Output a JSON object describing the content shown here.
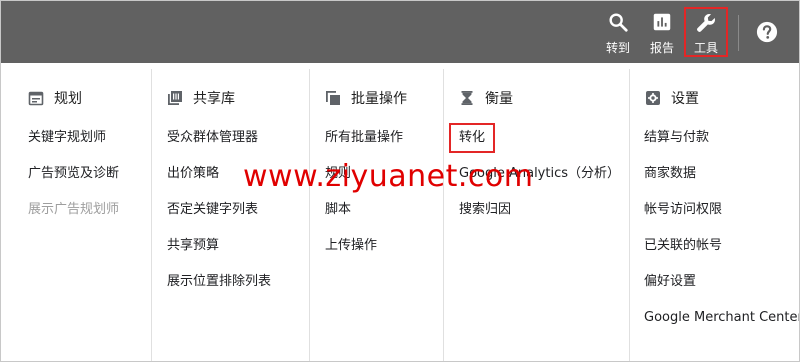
{
  "topbar": {
    "goto": {
      "label": "转到",
      "icon": "search-icon"
    },
    "reports": {
      "label": "报告",
      "icon": "bar-chart-icon"
    },
    "tools": {
      "label": "工具",
      "icon": "wrench-icon"
    },
    "help": {
      "icon": "help-icon"
    }
  },
  "columns": [
    {
      "title": "规划",
      "icon": "calendar-icon",
      "items": [
        {
          "label": "关键字规划师"
        },
        {
          "label": "广告预览及诊断"
        },
        {
          "label": "展示广告规划师"
        }
      ]
    },
    {
      "title": "共享库",
      "icon": "library-icon",
      "items": [
        {
          "label": "受众群体管理器"
        },
        {
          "label": "出价策略"
        },
        {
          "label": "否定关键字列表"
        },
        {
          "label": "共享预算"
        },
        {
          "label": "展示位置排除列表"
        }
      ]
    },
    {
      "title": "批量操作",
      "icon": "copy-icon",
      "items": [
        {
          "label": "所有批量操作"
        },
        {
          "label": "规则"
        },
        {
          "label": "脚本"
        },
        {
          "label": "上传操作"
        }
      ]
    },
    {
      "title": "衡量",
      "icon": "hourglass-icon",
      "items": [
        {
          "label": "转化"
        },
        {
          "label": "Google Analytics（分析）"
        },
        {
          "label": "搜索归因"
        }
      ]
    },
    {
      "title": "设置",
      "icon": "gear-icon",
      "items": [
        {
          "label": "结算与付款"
        },
        {
          "label": "商家数据"
        },
        {
          "label": "帐号访问权限"
        },
        {
          "label": "已关联的帐号"
        },
        {
          "label": "偏好设置"
        },
        {
          "label": "Google Merchant Center"
        }
      ]
    }
  ],
  "watermark": "www.ziyuanet.com",
  "colors": {
    "topbar": "#616161",
    "highlight": "#e32626",
    "disabled_text": "#9e9e9e",
    "watermark": "#e00000"
  }
}
